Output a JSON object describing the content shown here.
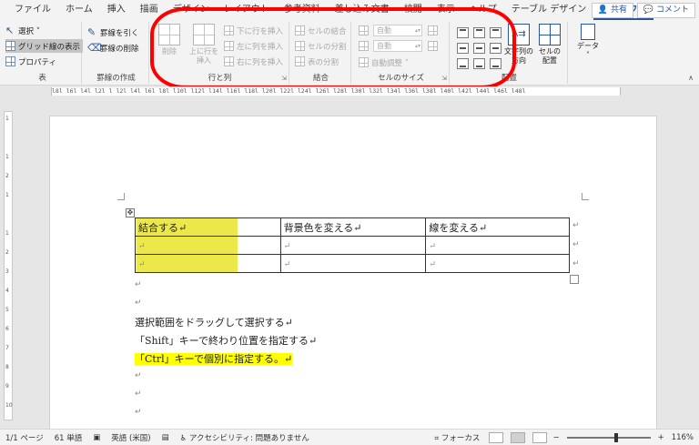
{
  "tabs": [
    {
      "label": "ファイル"
    },
    {
      "label": "ホーム"
    },
    {
      "label": "挿入"
    },
    {
      "label": "描画"
    },
    {
      "label": "デザイン"
    },
    {
      "label": "レイアウト"
    },
    {
      "label": "参考資料"
    },
    {
      "label": "差し込み文書"
    },
    {
      "label": "校閲"
    },
    {
      "label": "表示"
    },
    {
      "label": "ヘルプ"
    },
    {
      "label": "テーブル デザイン"
    },
    {
      "label": "レイアウト"
    }
  ],
  "active_tab_index": 12,
  "share_label": "共有",
  "comment_label": "コメント",
  "ribbon": {
    "table_group": {
      "label": "表",
      "select": "選択 ˅",
      "gridlines": "グリッド線の表示",
      "properties": "プロパティ"
    },
    "draw_group": {
      "label": "罫線の作成",
      "draw_borders": "罫線を引く",
      "eraser": "罫線の削除"
    },
    "rows_cols_group": {
      "label": "行と列",
      "delete": "削除",
      "insert_above": "上に行を\n挿入",
      "insert_below": "下に行を挿入",
      "insert_left": "左に列を挿入",
      "insert_right": "右に列を挿入"
    },
    "merge_group": {
      "label": "結合",
      "merge_cells": "セルの結合",
      "split_cells": "セルの分割",
      "split_table": "表の分割"
    },
    "cell_size_group": {
      "label": "セルのサイズ",
      "height": "自動",
      "width": "自動",
      "autofit": "自動調整 ˅"
    },
    "align_group": {
      "label": "配置",
      "text_direction": "文字列の\n方向",
      "cell_margins": "セルの\n配置"
    },
    "data_group": {
      "label": "データ"
    }
  },
  "ruler_text": "l8l l6l l4l l2l  l l2l l4l l6l l8l l10l l12l l14l l16l l18l l20l l22l l24l l26l l28l l30l l32l l34l l36l l38l l40l l42l l44l l46l l48l",
  "vruler_numbers": [
    "1",
    "",
    "1",
    "2",
    "1",
    "",
    "1",
    "2",
    "3",
    "4",
    "5",
    "6",
    "7",
    "8",
    "9",
    "10"
  ],
  "document": {
    "table": [
      [
        "結合する↵",
        "背景色を変える↵",
        "線を変える↵"
      ],
      [
        "↵",
        "↵",
        "↵"
      ],
      [
        "↵",
        "↵",
        "↵"
      ]
    ],
    "row_end_mark": "↵",
    "empty_paragraph": "↵",
    "lines": [
      "選択範囲をドラッグして選択する↵",
      "「Shift」キーで終わり位置を指定する↵",
      "「Ctrl」キーで個別に指定する。↵"
    ],
    "highlight_color": "#ffff00",
    "cell_highlight_color": "#ece84a"
  },
  "status": {
    "page": "1/1 ページ",
    "words": "61 単語",
    "language": "英語 (米国)",
    "accessibility": "アクセシビリティ: 問題ありません",
    "focus": "フォーカス",
    "zoom": "116%",
    "zoom_fraction": 0.6
  },
  "colors": {
    "accent": "#2b579a",
    "annotation": "#ff0000"
  }
}
